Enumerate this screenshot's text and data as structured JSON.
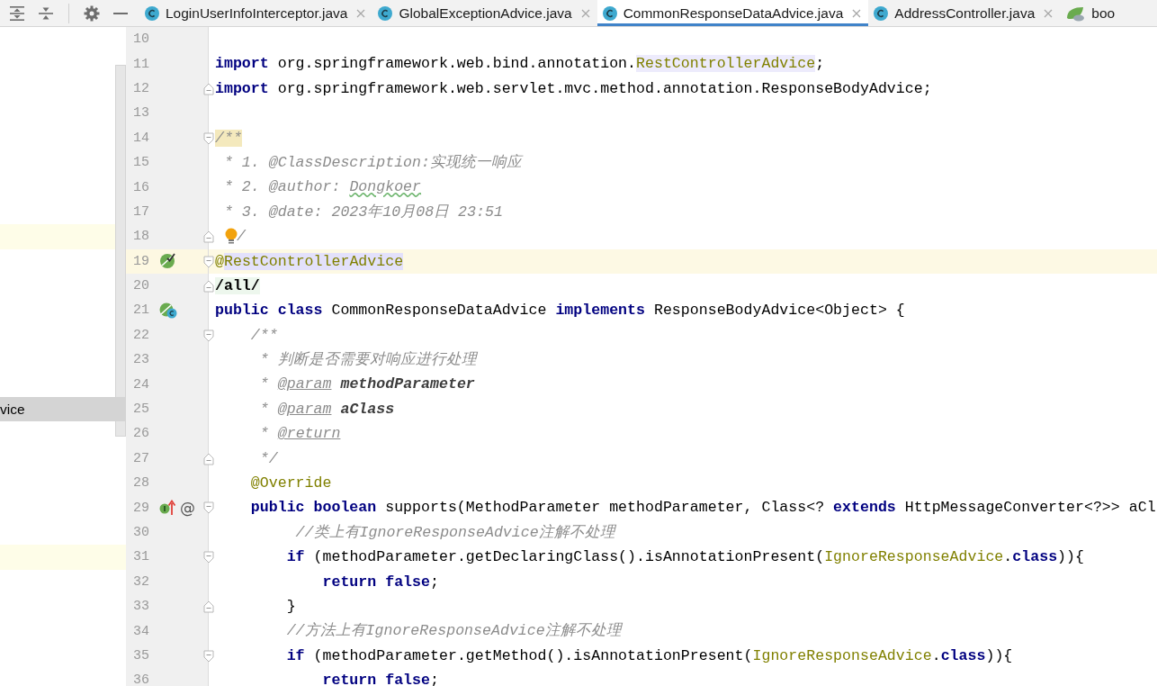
{
  "tab_bar": {
    "tool_icons": [
      {
        "kind": "expand-all"
      },
      {
        "kind": "collapse-all"
      },
      {
        "kind": "settings"
      },
      {
        "kind": "minimize"
      }
    ],
    "tabs": [
      {
        "label": "LoginUserInfoInterceptor.java",
        "kind": "class",
        "selected": false,
        "closable": true
      },
      {
        "label": "GlobalExceptionAdvice.java",
        "kind": "class",
        "selected": false,
        "closable": true
      },
      {
        "label": "CommonResponseDataAdvice.java",
        "kind": "class",
        "selected": true,
        "closable": true
      },
      {
        "label": "AddressController.java",
        "kind": "class",
        "selected": false,
        "closable": true
      },
      {
        "label": "boo",
        "kind": "spring",
        "selected": false,
        "closable": false
      }
    ]
  },
  "editor": {
    "lines": [
      {
        "number": "10"
      },
      {
        "number": "11",
        "tokens": [
          {
            "kind": "keyword",
            "text": "import"
          },
          {
            "kind": "plain",
            "text": " org.springframework.web.bind.annotation."
          },
          {
            "kind": "annotation",
            "text": "RestControllerAdvice",
            "search_match": true
          },
          {
            "kind": "plain",
            "text": ";"
          }
        ]
      },
      {
        "number": "12",
        "fold_end": true,
        "tokens": [
          {
            "kind": "keyword",
            "text": "import"
          },
          {
            "kind": "plain",
            "text": " org.springframework.web.servlet.mvc.method.annotation.ResponseBodyAdvice;"
          }
        ]
      },
      {
        "number": "13"
      },
      {
        "number": "14",
        "fold_start": true,
        "tokens": [
          {
            "kind": "doc",
            "text": "/**",
            "brace_match": true
          }
        ]
      },
      {
        "number": "15",
        "tokens": [
          {
            "kind": "doc",
            "text": " * 1. @ClassDescription:实现统一响应"
          }
        ]
      },
      {
        "number": "16",
        "tokens": [
          {
            "kind": "doc",
            "text": " * 2. @author: "
          },
          {
            "kind": "doc",
            "text": "Dongkoer",
            "typo": true
          }
        ]
      },
      {
        "number": "17",
        "tokens": [
          {
            "kind": "doc",
            "text": " * 3. @date: 2023年10月08日 23:51"
          }
        ]
      },
      {
        "number": "18",
        "fold_end": true,
        "bulb": true,
        "tree_row": {
          "kind": "highlight"
        },
        "tokens": [
          {
            "kind": "doc",
            "text": "/"
          }
        ]
      },
      {
        "number": "19",
        "fold_start": true,
        "current": true,
        "gutter_icons": [
          {
            "kind": "bean"
          }
        ],
        "tokens": [
          {
            "kind": "annotation",
            "text": "@"
          },
          {
            "kind": "annotation",
            "text": "RestControllerAdvice",
            "usage": true
          }
        ]
      },
      {
        "number": "20",
        "fold_end": true,
        "tokens": [
          {
            "kind": "bold",
            "text": "/all/",
            "injected": true
          }
        ]
      },
      {
        "number": "21",
        "gutter_icons": [
          {
            "kind": "bean-class"
          }
        ],
        "tokens": [
          {
            "kind": "keyword",
            "text": "public class"
          },
          {
            "kind": "plain",
            "text": " CommonResponseDataAdvice "
          },
          {
            "kind": "keyword",
            "text": "implements"
          },
          {
            "kind": "plain",
            "text": " ResponseBodyAdvice<Object> {"
          }
        ]
      },
      {
        "number": "22",
        "fold_start": true,
        "tokens": [
          {
            "kind": "doc",
            "text": "    /**"
          }
        ]
      },
      {
        "number": "23",
        "tokens": [
          {
            "kind": "doc",
            "text": "     * 判断是否需要对响应进行处理"
          }
        ]
      },
      {
        "number": "24",
        "tokens": [
          {
            "kind": "doc",
            "text": "     * "
          },
          {
            "kind": "doctag",
            "text": "@param"
          },
          {
            "kind": "docparam",
            "text": " methodParameter"
          }
        ]
      },
      {
        "number": "25",
        "tree_row": {
          "kind": "item",
          "label": "vice",
          "selected": true
        },
        "tokens": [
          {
            "kind": "doc",
            "text": "     * "
          },
          {
            "kind": "doctag",
            "text": "@param"
          },
          {
            "kind": "docparam",
            "text": " aClass"
          }
        ]
      },
      {
        "number": "26",
        "tokens": [
          {
            "kind": "doc",
            "text": "     * "
          },
          {
            "kind": "doctag",
            "text": "@return"
          }
        ]
      },
      {
        "number": "27",
        "fold_end": true,
        "tokens": [
          {
            "kind": "doc",
            "text": "     */"
          }
        ]
      },
      {
        "number": "28",
        "tokens": [
          {
            "kind": "annotation",
            "text": "    @Override"
          }
        ]
      },
      {
        "number": "29",
        "fold_start": true,
        "gutter_icons": [
          {
            "kind": "implements"
          },
          {
            "kind": "text",
            "text": "@"
          }
        ],
        "tokens": [
          {
            "kind": "keyword",
            "text": "    public boolean"
          },
          {
            "kind": "plain",
            "text": " supports(MethodParameter methodParameter, Class<? "
          },
          {
            "kind": "keyword",
            "text": "extends"
          },
          {
            "kind": "plain",
            "text": " HttpMessageConverter<?>> aCl"
          }
        ]
      },
      {
        "number": "30",
        "tokens": [
          {
            "kind": "comment",
            "text": "         //类上有IgnoreResponseAdvice注解不处理"
          }
        ]
      },
      {
        "number": "31",
        "fold_start": true,
        "tree_row": {
          "kind": "highlight"
        },
        "tokens": [
          {
            "kind": "keyword",
            "text": "        if"
          },
          {
            "kind": "plain",
            "text": " (methodParameter.getDeclaringClass().isAnnotationPresent("
          },
          {
            "kind": "annotation",
            "text": "IgnoreResponseAdvice"
          },
          {
            "kind": "plain",
            "text": "."
          },
          {
            "kind": "keyword",
            "text": "class"
          },
          {
            "kind": "plain",
            "text": ")){"
          }
        ]
      },
      {
        "number": "32",
        "tokens": [
          {
            "kind": "keyword",
            "text": "            return false"
          },
          {
            "kind": "plain",
            "text": ";"
          }
        ]
      },
      {
        "number": "33",
        "fold_end": true,
        "tokens": [
          {
            "kind": "plain",
            "text": "        }"
          }
        ]
      },
      {
        "number": "34",
        "tokens": [
          {
            "kind": "comment",
            "text": "        //方法上有IgnoreResponseAdvice注解不处理"
          }
        ]
      },
      {
        "number": "35",
        "fold_start": true,
        "tokens": [
          {
            "kind": "keyword",
            "text": "        if"
          },
          {
            "kind": "plain",
            "text": " (methodParameter.getMethod().isAnnotationPresent("
          },
          {
            "kind": "annotation",
            "text": "IgnoreResponseAdvice"
          },
          {
            "kind": "plain",
            "text": "."
          },
          {
            "kind": "keyword",
            "text": "class"
          },
          {
            "kind": "plain",
            "text": ")){"
          }
        ]
      },
      {
        "number": "36",
        "tokens": [
          {
            "kind": "keyword",
            "text": "            return false"
          },
          {
            "kind": "plain",
            "text": ";"
          }
        ]
      }
    ]
  }
}
